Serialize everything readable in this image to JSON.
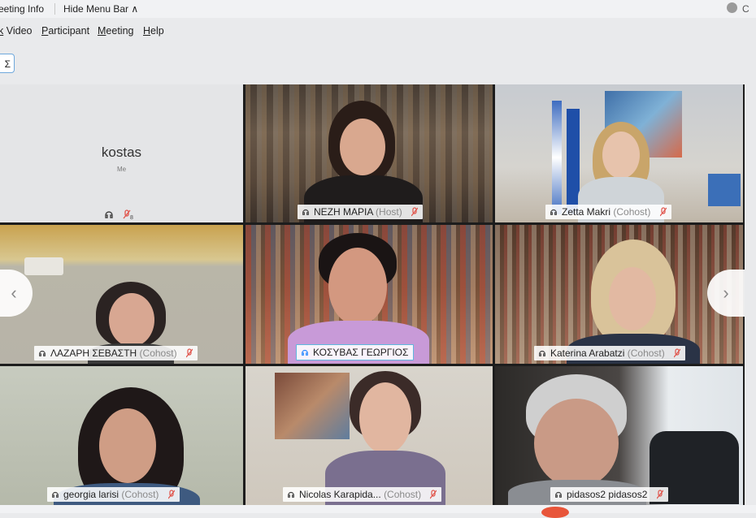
{
  "topbar": {
    "meeting_info": "eeting Info",
    "hide_menu": "Hide Menu Bar ∧",
    "right_char": "C"
  },
  "menu": [
    "k Video",
    "Participant",
    "Meeting",
    "Help"
  ],
  "lang_badge": "Σ",
  "self_tile": {
    "name": "kostas",
    "sub": "Me"
  },
  "participants": [
    {
      "name": "ΝΕΖΗ ΜΑΡΙΑ",
      "role": "(Host)"
    },
    {
      "name": "Zetta Makri",
      "role": "(Cohost)"
    },
    {
      "name": "ΛΑΖΑΡΗ ΣΕΒΑΣΤΗ",
      "role": "(Cohost)"
    },
    {
      "name": "ΚΟΣΥΒΑΣ ΓΕΩΡΓΙΟΣ",
      "role": ""
    },
    {
      "name": "Katerina Arabatzi",
      "role": "(Cohost)"
    },
    {
      "name": "georgia larisi",
      "role": "(Cohost)"
    },
    {
      "name": "Nicolas Karapida...",
      "role": "(Cohost)"
    },
    {
      "name": "pidasos2 pidasos2",
      "role": ""
    }
  ],
  "nav": {
    "left": "‹",
    "right": "›"
  },
  "colors": {
    "active_border": "#5fb7de",
    "muted_red": "#e0534a",
    "accent_blue": "#2d8cff"
  }
}
